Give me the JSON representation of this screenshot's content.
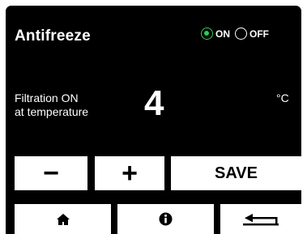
{
  "screen": {
    "title": "Antifreeze",
    "mode": {
      "selected": "ON",
      "on_label": "ON",
      "off_label": "OFF"
    },
    "description": "Filtration ON at temperature",
    "description_line1": "Filtration ON",
    "description_line2": "at temperature",
    "value": "4",
    "unit": "°C",
    "buttons": {
      "minus_label": "−",
      "plus_label": "+",
      "save_label": "SAVE"
    },
    "nav": [
      "home-icon",
      "info-icon",
      "back-arrow-icon"
    ]
  },
  "colors": {
    "background": "#000000",
    "button": "#ffffff",
    "accent_on": "#2ecc55"
  }
}
